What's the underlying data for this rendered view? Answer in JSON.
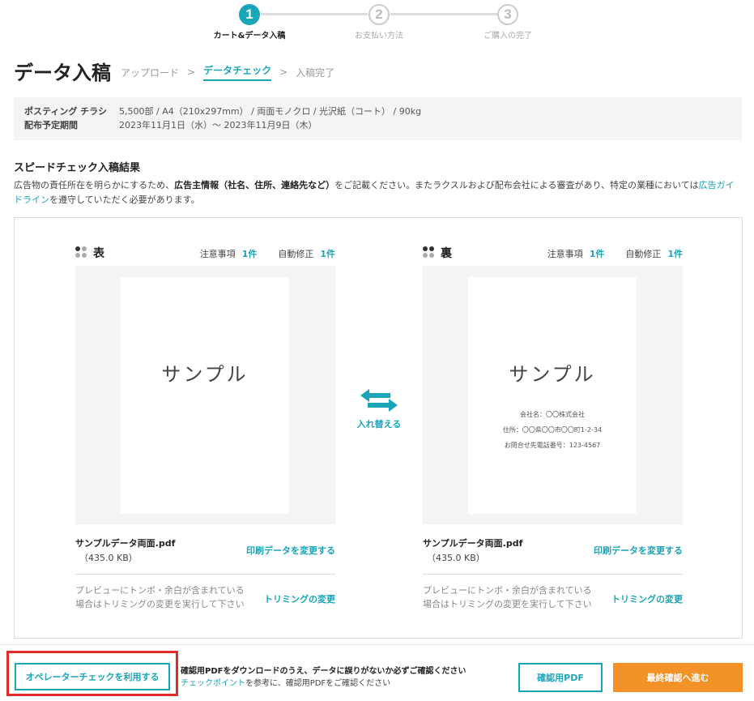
{
  "stepper": {
    "steps": [
      {
        "number": "1",
        "label": "カート&データ入稿",
        "state": "active"
      },
      {
        "number": "2",
        "label": "お支払い方法",
        "state": "inactive"
      },
      {
        "number": "3",
        "label": "ご購入の完了",
        "state": "inactive"
      }
    ]
  },
  "header": {
    "title": "データ入稿",
    "breadcrumb": [
      {
        "label": "アップロード"
      },
      {
        "label": "データチェック"
      },
      {
        "label": "入稿完了"
      }
    ],
    "separator": ">"
  },
  "info": {
    "product_label": "ポスティング チラシ",
    "product_value": "5,500部 /  A4（210x297mm） / 両面モノクロ / 光沢紙（コート） / 90kg",
    "period_label": "配布予定期間",
    "period_value": "2023年11月1日（水）～ 2023年11月9日（木）"
  },
  "section": {
    "title": "スピードチェック入稿結果",
    "desc_1": "広告物の責任所在を明らかにするため、",
    "desc_bold": "広告主情報（社名、住所、連絡先など）",
    "desc_2": "をご記載ください。またラクスルおよび配布会社による審査があり、特定の業種においては",
    "desc_link": "広告ガイドライン",
    "desc_3": "を遵守していただく必要があります。"
  },
  "sides": {
    "front": {
      "name": "表",
      "caution_label": "注意事項",
      "caution_count": "1件",
      "autofix_label": "自動修正",
      "autofix_count": "1件",
      "sample_text": "サンプル",
      "file_name": "サンプルデータ両面.pdf",
      "file_size": "（435.0 KB）",
      "change_link": "印刷データを変更する",
      "trim_note_1": "プレビューにトンボ・余白が含まれている",
      "trim_note_2": "場合はトリミングの変更を実行して下さい",
      "trim_link": "トリミングの変更"
    },
    "back": {
      "name": "裏",
      "caution_label": "注意事項",
      "caution_count": "1件",
      "autofix_label": "自動修正",
      "autofix_count": "1件",
      "sample_text": "サンプル",
      "company": "会社名：〇〇株式会社",
      "address": "住所：〇〇県〇〇市〇〇町1-2-34",
      "phone": "お問合せ先電話番号：123-4567",
      "file_name": "サンプルデータ両面.pdf",
      "file_size": "（435.0 KB）",
      "change_link": "印刷データを変更する",
      "trim_note_1": "プレビューにトンボ・余白が含まれている",
      "trim_note_2": "場合はトリミングの変更を実行して下さい",
      "trim_link": "トリミングの変更"
    }
  },
  "swap": {
    "label": "入れ替える",
    "icon": "swap-arrows-icon"
  },
  "footer": {
    "operator_button": "オペレーターチェックを利用する",
    "note_line1": "確認用PDFをダウンロードのうえ、データに誤りがないか必ずご確認ください",
    "note_link": "チェックポイント",
    "note_line2": "を参考に、確認用PDFをご確認ください",
    "pdf_button": "確認用PDF",
    "next_button": "最終確認へ進む"
  },
  "colors": {
    "accent": "#1ba5b8",
    "orange": "#f39227",
    "highlight": "#e02a2a"
  }
}
